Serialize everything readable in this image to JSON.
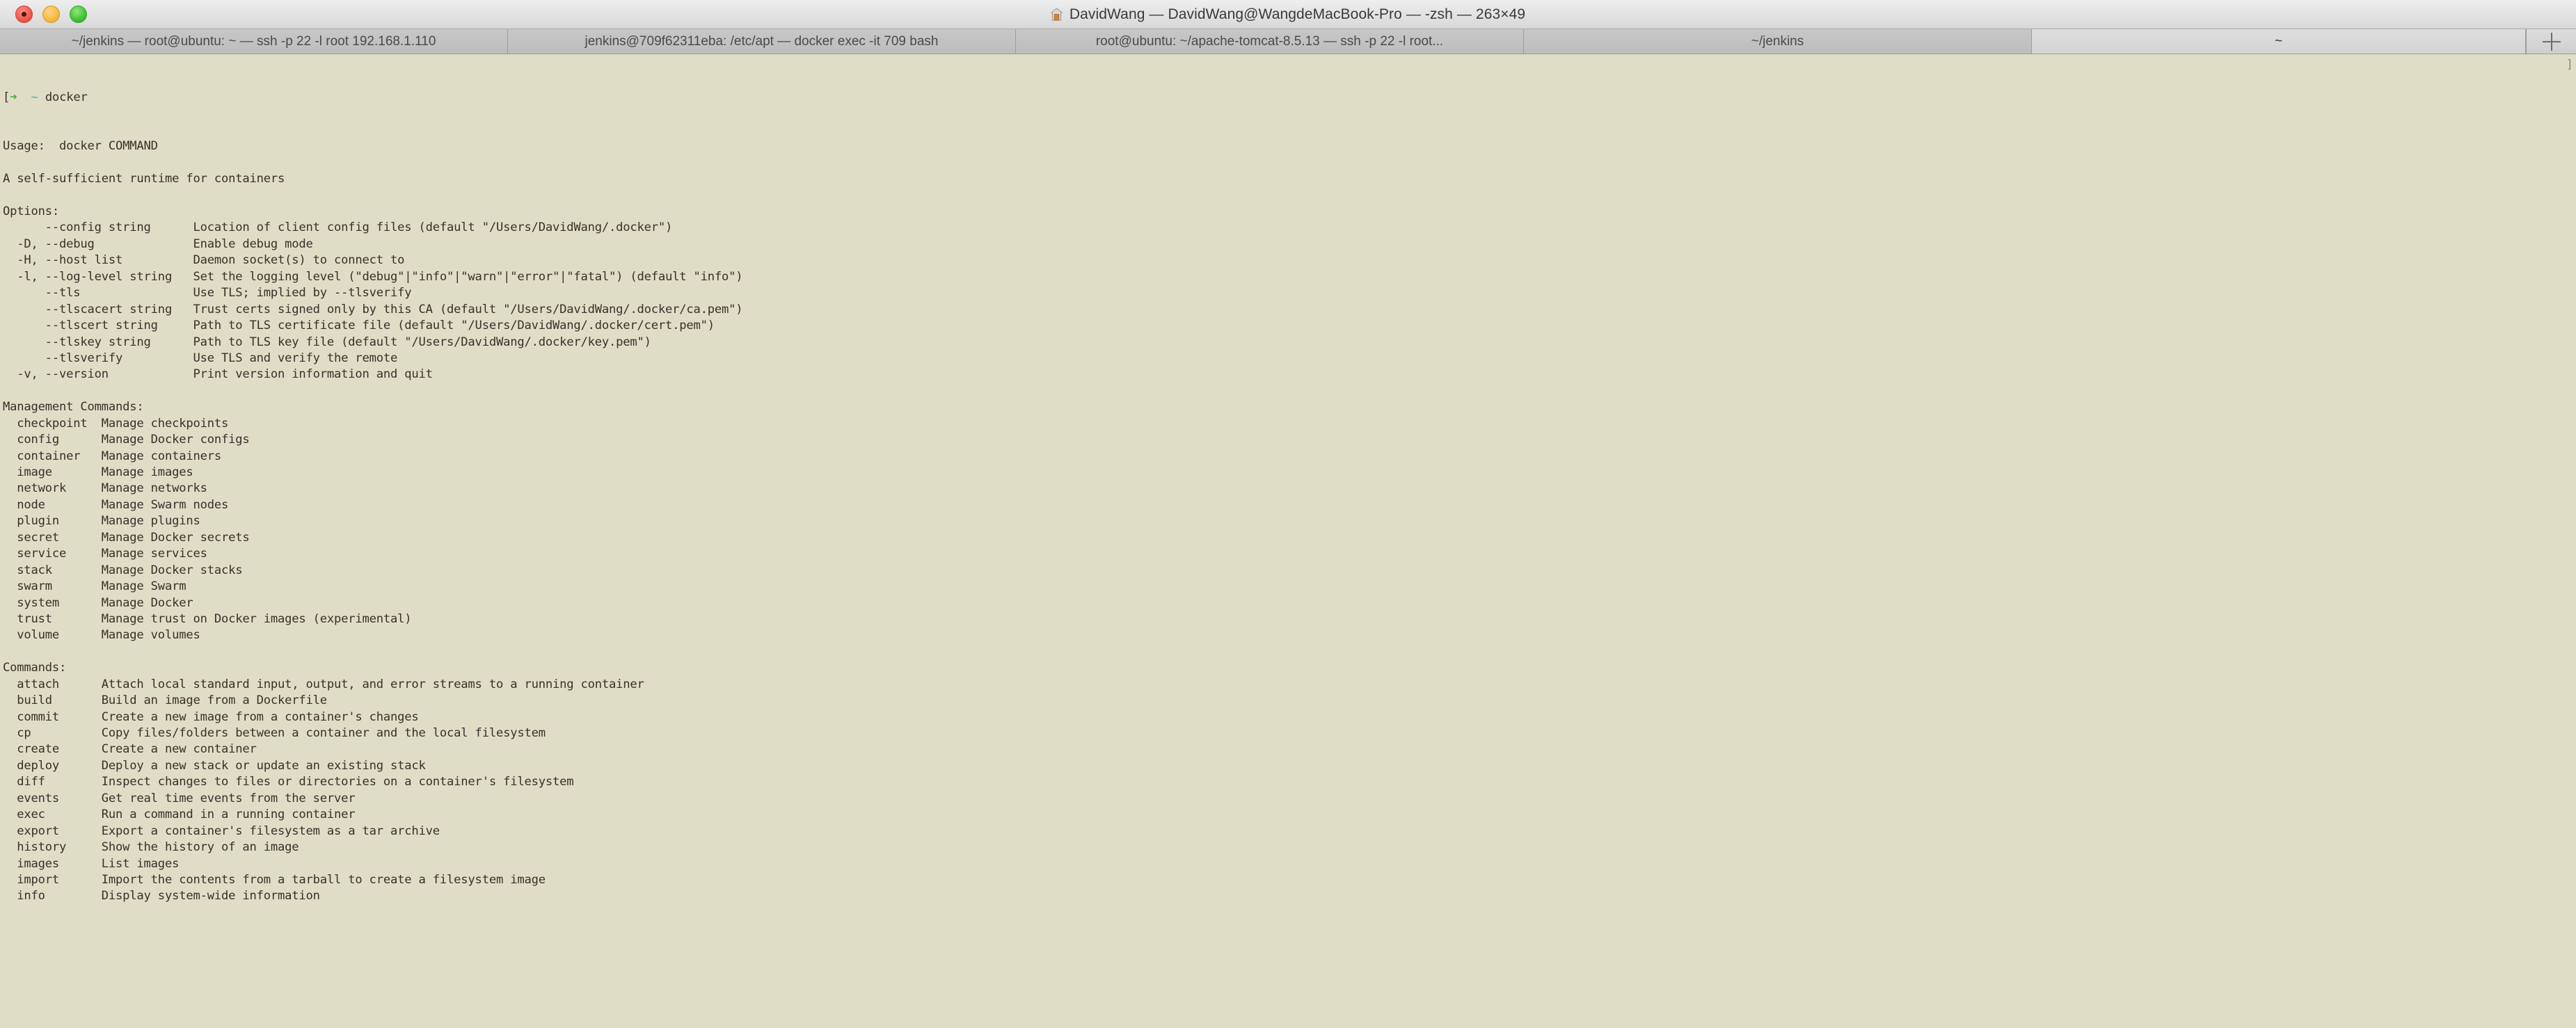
{
  "window": {
    "title": "DavidWang — DavidWang@WangdeMacBook-Pro — -zsh — 263×49",
    "home_icon": "home-icon",
    "traffic_lights": {
      "close": "close-button",
      "minimize": "minimize-button",
      "maximize": "maximize-button"
    }
  },
  "tabbar": {
    "new_tab_label": "+",
    "tabs": [
      {
        "label": "~/jenkins — root@ubuntu: ~ — ssh -p 22 -l root 192.168.1.110",
        "active": false
      },
      {
        "label": "jenkins@709f62311eba: /etc/apt — docker exec -it 709 bash",
        "active": false
      },
      {
        "label": "root@ubuntu: ~/apache-tomcat-8.5.13 — ssh -p 22 -l root...",
        "active": false
      },
      {
        "label": "~/jenkins",
        "active": false
      },
      {
        "label": "~",
        "active": true
      }
    ]
  },
  "terminal": {
    "right_edge_marker": "]",
    "prompt": {
      "bracket": "[",
      "arrow": "➜",
      "cwd": "~",
      "command": "docker"
    },
    "colors": {
      "background": "#e0ddc7",
      "foreground": "#3b2f2a",
      "prompt_arrow": "#3bb33b",
      "prompt_cwd": "#4aa8b8"
    },
    "output_lines": [
      "Usage:  docker COMMAND",
      "",
      "A self-sufficient runtime for containers",
      "",
      "Options:",
      "      --config string      Location of client config files (default \"/Users/DavidWang/.docker\")",
      "  -D, --debug              Enable debug mode",
      "  -H, --host list          Daemon socket(s) to connect to",
      "  -l, --log-level string   Set the logging level (\"debug\"|\"info\"|\"warn\"|\"error\"|\"fatal\") (default \"info\")",
      "      --tls                Use TLS; implied by --tlsverify",
      "      --tlscacert string   Trust certs signed only by this CA (default \"/Users/DavidWang/.docker/ca.pem\")",
      "      --tlscert string     Path to TLS certificate file (default \"/Users/DavidWang/.docker/cert.pem\")",
      "      --tlskey string      Path to TLS key file (default \"/Users/DavidWang/.docker/key.pem\")",
      "      --tlsverify          Use TLS and verify the remote",
      "  -v, --version            Print version information and quit",
      "",
      "Management Commands:",
      "  checkpoint  Manage checkpoints",
      "  config      Manage Docker configs",
      "  container   Manage containers",
      "  image       Manage images",
      "  network     Manage networks",
      "  node        Manage Swarm nodes",
      "  plugin      Manage plugins",
      "  secret      Manage Docker secrets",
      "  service     Manage services",
      "  stack       Manage Docker stacks",
      "  swarm       Manage Swarm",
      "  system      Manage Docker",
      "  trust       Manage trust on Docker images (experimental)",
      "  volume      Manage volumes",
      "",
      "Commands:",
      "  attach      Attach local standard input, output, and error streams to a running container",
      "  build       Build an image from a Dockerfile",
      "  commit      Create a new image from a container's changes",
      "  cp          Copy files/folders between a container and the local filesystem",
      "  create      Create a new container",
      "  deploy      Deploy a new stack or update an existing stack",
      "  diff        Inspect changes to files or directories on a container's filesystem",
      "  events      Get real time events from the server",
      "  exec        Run a command in a running container",
      "  export      Export a container's filesystem as a tar archive",
      "  history     Show the history of an image",
      "  images      List images",
      "  import      Import the contents from a tarball to create a filesystem image",
      "  info        Display system-wide information"
    ]
  }
}
